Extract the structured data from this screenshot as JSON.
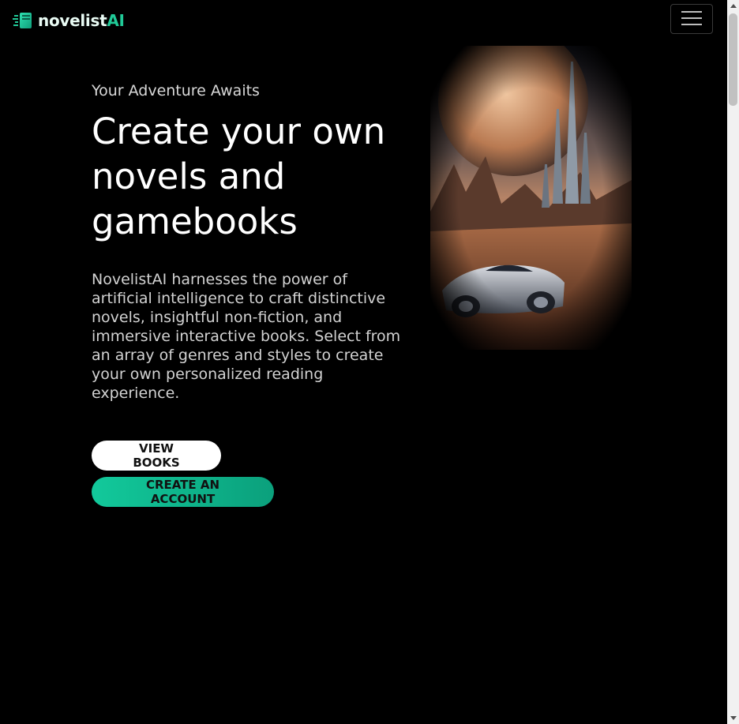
{
  "brand": {
    "name_part1": "novelist",
    "name_part2": "AI",
    "logo_icon": "book-stack-icon",
    "accent": "#20c997"
  },
  "nav": {
    "menu_icon": "hamburger-icon"
  },
  "hero": {
    "eyebrow": "Your Adventure Awaits",
    "headline": "Create your own novels and gamebooks",
    "description": "NovelistAI harnesses the power of artificial intelligence to craft distinctive novels, insightful non-fiction, and immersive interactive books. Select from an array of genres and styles to create your own personalized reading experience.",
    "view_books_label": "VIEW BOOKS",
    "create_account_label": "CREATE AN ACCOUNT",
    "image_subject": "sci-fi desert planet with spire city and futuristic car"
  },
  "colors": {
    "background": "#000000",
    "primary_button": "#ffffff",
    "accent_button": "#12c99b"
  }
}
